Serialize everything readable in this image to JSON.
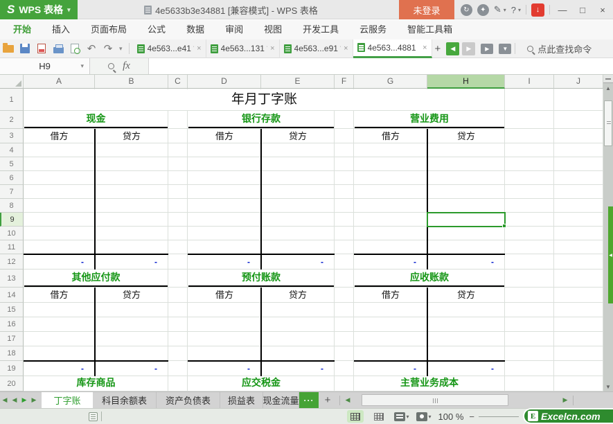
{
  "colors": {
    "accent_green": "#3f9e37",
    "selection_green": "#2b9a2b",
    "section_title_green": "#169616",
    "dash_blue": "#0019cc",
    "login_bg": "#e0714f",
    "download_red": "#e23c30",
    "logo_green": "#45a33c"
  },
  "icons": {
    "caret_down": "▾",
    "minimize": "—",
    "maximize": "□",
    "close": "×",
    "undo": "↶",
    "redo": "↷",
    "arrow_left": "◀",
    "arrow_right": "▶",
    "arrow_up": "▲",
    "arrow_down": "▼",
    "plus": "+",
    "dots": "···",
    "play": "▶",
    "download": "↓"
  },
  "titlebar": {
    "app_logo_glyph": "S",
    "app_label": "WPS 表格",
    "document_title": "4e5633b3e34881 [兼容模式] - WPS 表格",
    "login_label": "未登录"
  },
  "menubar": {
    "tabs": [
      {
        "label": "开始",
        "active": true
      },
      {
        "label": "插入",
        "active": false
      },
      {
        "label": "页面布局",
        "active": false
      },
      {
        "label": "公式",
        "active": false
      },
      {
        "label": "数据",
        "active": false
      },
      {
        "label": "审阅",
        "active": false
      },
      {
        "label": "视图",
        "active": false
      },
      {
        "label": "开发工具",
        "active": false
      },
      {
        "label": "云服务",
        "active": false
      },
      {
        "label": "智能工具箱",
        "active": false
      }
    ]
  },
  "toolbar": {
    "doc_tabs": [
      {
        "label": "4e563...e41 *",
        "active": false
      },
      {
        "label": "4e563...131 *",
        "active": false
      },
      {
        "label": "4e563...e91 *",
        "active": false
      },
      {
        "label": "4e563...4881",
        "active": true
      }
    ],
    "search_label": "点此查找命令"
  },
  "formula_bar": {
    "name_box": "H9",
    "fx_label": "fx",
    "formula_value": ""
  },
  "grid": {
    "columns": [
      "A",
      "B",
      "C",
      "D",
      "E",
      "F",
      "G",
      "H",
      "I",
      "J"
    ],
    "visible_rows": 20,
    "selected_cell": "H9",
    "selected_column": "H",
    "selected_row": 9,
    "title": "年月丁字账",
    "debit_label": "借方",
    "credit_label": "贷方",
    "dash": "-",
    "sections": [
      {
        "title_row": 2,
        "header_row": 3,
        "total_row": 12,
        "accounts": [
          {
            "title": "现金",
            "cols": [
              "A",
              "B"
            ]
          },
          {
            "title": "银行存款",
            "cols": [
              "D",
              "E"
            ]
          },
          {
            "title": "营业费用",
            "cols": [
              "G",
              "H"
            ]
          }
        ]
      },
      {
        "title_row": 13,
        "header_row": 14,
        "total_row": 19,
        "accounts": [
          {
            "title": "其他应付款",
            "cols": [
              "A",
              "B"
            ]
          },
          {
            "title": "预付账款",
            "cols": [
              "D",
              "E"
            ]
          },
          {
            "title": "应收账款",
            "cols": [
              "G",
              "H"
            ]
          }
        ]
      },
      {
        "title_row": 20,
        "accounts": [
          {
            "title": "库存商品",
            "cols": [
              "A",
              "B"
            ]
          },
          {
            "title": "应交税金",
            "cols": [
              "D",
              "E"
            ]
          },
          {
            "title": "主营业务成本",
            "cols": [
              "G",
              "H"
            ]
          }
        ]
      }
    ]
  },
  "sheet_bar": {
    "tabs": [
      {
        "label": "丁字账",
        "active": true
      },
      {
        "label": "科目余额表",
        "active": false
      },
      {
        "label": "资产负债表",
        "active": false
      },
      {
        "label": "损益表",
        "active": false
      },
      {
        "label": "现金流量",
        "active": false
      }
    ]
  },
  "status_bar": {
    "zoom_label": "100 %",
    "zoom_minus": "−",
    "watermark_badge": "E",
    "watermark_text": "Excelcn.com"
  }
}
